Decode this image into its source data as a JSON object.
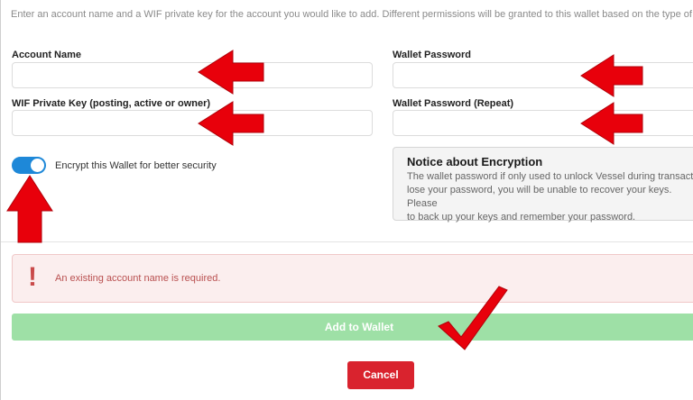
{
  "intro": "Enter an account name and a WIF private key for the account you would like to add. Different permissions will be granted to this wallet based on the type of key u",
  "fields": {
    "account_name_label": "Account Name",
    "account_name_value": "",
    "wif_label": "WIF Private Key (posting, active or owner)",
    "wif_value": "",
    "wallet_password_label": "Wallet Password",
    "wallet_password_value": "",
    "wallet_password_repeat_label": "Wallet Password (Repeat)",
    "wallet_password_repeat_value": ""
  },
  "encrypt_toggle": {
    "label": "Encrypt this Wallet for better security",
    "on": true
  },
  "notice": {
    "title": "Notice about Encryption",
    "lines": [
      "The wallet password if only used to unlock Vessel during transactio",
      "lose your password, you will be unable to recover your keys. Please",
      "to back up your keys and remember your password."
    ]
  },
  "alert": {
    "icon": "exclamation-icon",
    "text": "An existing account name is required."
  },
  "buttons": {
    "add": "Add to Wallet",
    "cancel": "Cancel"
  },
  "colors": {
    "toggle": "#1e88d8",
    "add_button": "#9ee0a6",
    "cancel_button": "#d9232e",
    "alert_bg": "#fbeeee",
    "annotation": "#e8000b"
  }
}
